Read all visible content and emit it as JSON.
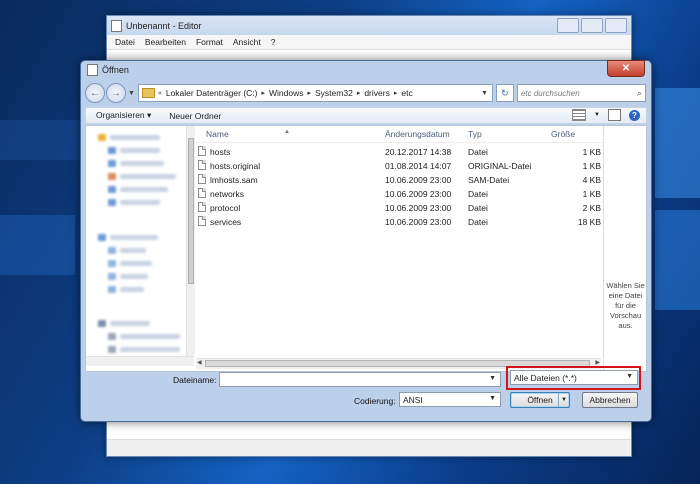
{
  "notepad": {
    "title": "Unbenannt - Editor",
    "menu": [
      "Datei",
      "Bearbeiten",
      "Format",
      "Ansicht",
      "?"
    ]
  },
  "dialog": {
    "title": "Öffnen",
    "close_symbol": "✕",
    "address": {
      "crumbs": [
        "Lokaler Datenträger (C:)",
        "Windows",
        "System32",
        "drivers",
        "etc"
      ]
    },
    "search_placeholder": "etc durchsuchen",
    "toolbar": {
      "organize_label": "Organisieren ▾",
      "new_folder_label": "Neuer Ordner"
    },
    "columns": {
      "name": "Name",
      "date": "Änderungsdatum",
      "type": "Typ",
      "size": "Größe"
    },
    "files": [
      {
        "name": "hosts",
        "date": "20.12.2017 14:38",
        "type": "Datei",
        "size": "1 KB"
      },
      {
        "name": "hosts.original",
        "date": "01.08.2014 14:07",
        "type": "ORIGINAL-Datei",
        "size": "1 KB"
      },
      {
        "name": "lmhosts.sam",
        "date": "10.06.2009 23:00",
        "type": "SAM-Datei",
        "size": "4 KB"
      },
      {
        "name": "networks",
        "date": "10.06.2009 23:00",
        "type": "Datei",
        "size": "1 KB"
      },
      {
        "name": "protocol",
        "date": "10.06.2009 23:00",
        "type": "Datei",
        "size": "2 KB"
      },
      {
        "name": "services",
        "date": "10.06.2009 23:00",
        "type": "Datei",
        "size": "18 KB"
      }
    ],
    "preview_text": [
      "Wählen Sie",
      "eine Datei",
      "für die",
      "Vorschau",
      "aus."
    ],
    "filename_label": "Dateiname:",
    "filename_value": "",
    "filetype_value": "Alle Dateien  (*.*)",
    "encoding_label": "Codierung:",
    "encoding_value": "ANSI",
    "open_label": "Öffnen",
    "cancel_label": "Abbrechen"
  },
  "colors": {
    "highlight": "#d4141b",
    "desktop_blue": "#0d3f86"
  }
}
